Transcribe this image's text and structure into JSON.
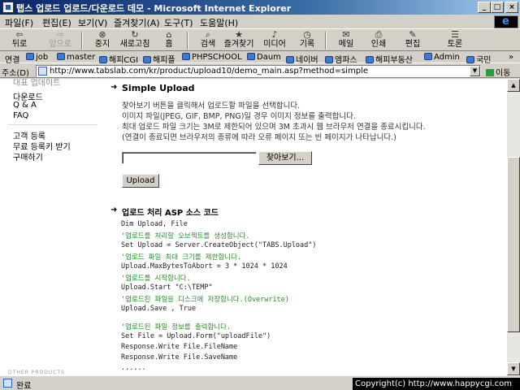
{
  "window": {
    "title": "탭스 업로드 업로드/다운로드 데모 - Microsoft Internet Explorer",
    "min_glyph": "_",
    "max_glyph": "□",
    "close_glyph": "×"
  },
  "menu": {
    "file": "파일(F)",
    "edit": "편집(E)",
    "view": "보기(V)",
    "favorites": "즐겨찾기(A)",
    "tools": "도구(T)",
    "help": "도움말(H)"
  },
  "toolbar": {
    "back": "뒤로",
    "forward": "앞으로",
    "stop": "중지",
    "refresh": "새로고침",
    "home": "홈",
    "search": "검색",
    "favorites": "즐겨찾기",
    "media": "미디어",
    "history": "기록",
    "mail": "메일",
    "print": "인쇄",
    "edit": "편집",
    "discuss": "토론"
  },
  "links": {
    "label": "연결",
    "items": [
      "job",
      "master",
      "해피CGI",
      "해피플",
      "PHPSCHOOL",
      "Daum",
      "네이버",
      "엠파스",
      "해피부동산",
      "Admin",
      "국민"
    ],
    "more": "»"
  },
  "address": {
    "label": "주소(D)",
    "url": "http://www.tabslab.com/kr/product/upload10/demo_main.asp?method=simple",
    "go": "이동"
  },
  "sidebar": {
    "cut_text": "대표 업데이트",
    "download": "다운로드",
    "qa": "Q & A",
    "faq": "FAQ",
    "register": "고객 등록",
    "free_key": "무료 등록키 받기",
    "buy": "구매하기",
    "other_products": "OTHER PRODUCTS"
  },
  "main": {
    "section1_title": "Simple Upload",
    "desc": [
      "찾아보기 버튼을 클릭해서 업로드할 파일을 선택합니다.",
      "이미지 파일(JPEG, GIF, BMP, PNG)일 경우 이미지 정보를 출력합니다.",
      "최대 업로드 파일 크기는 3M로 제한되어 있으며 3M 초과시 웹 브라우저 연결을 종료시킵니다.",
      "(연결이 종료되면 브라우저의 종류에 따라 오류 페이지 또는 빈 페이지가 나타납니다.)"
    ],
    "file_value": "",
    "browse_label": "찾아보기...",
    "upload_label": "Upload",
    "section2_title": "업로드 처리 ASP 소스 코드",
    "code_lines": [
      "Dim Upload, File",
      "'업로드를 처리할 오브젝트를 생성합니다.",
      "Set Upload = Server.CreateObject(\"TABS.Upload\")",
      "'업로드 파일 최대 크기를 제한합니다.",
      "Upload.MaxBytesToAbort = 3 * 1024 * 1024",
      "'업로드를 시작합니다.",
      "Upload.Start \"C:\\TEMP\"",
      "'업로드된 파일을 디스크에 저장합니다.(Overwrite)",
      "Upload.Save , True",
      "",
      "'업로드된 파일 정보를 출력합니다.",
      "Set File = Upload.Form(\"uploadFile\")",
      "Response.Write File.FileName",
      "Response.Write File.SaveName",
      "......"
    ]
  },
  "status": {
    "text": "완료",
    "copyright": "Copyright(c) http://www.happycgi.com"
  },
  "colors": {
    "titlebar": "#0a246a",
    "comment": "#2a8a2a",
    "chrome": "#d4d0c8"
  }
}
